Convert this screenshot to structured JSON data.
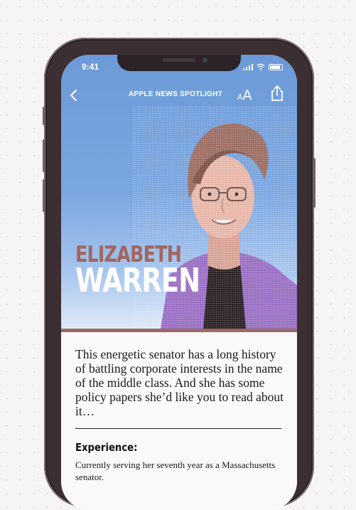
{
  "status_bar": {
    "time": "9:41",
    "icons": [
      "signal-icon",
      "wifi-icon",
      "battery-icon"
    ]
  },
  "navbar": {
    "back_icon": "chevron-left-icon",
    "title": "APPLE NEWS SPOTLIGHT",
    "text_size_small": "A",
    "text_size_large": "A",
    "share_icon": "share-icon"
  },
  "hero": {
    "first_name": "ELIZABETH",
    "last_name": "WARREN",
    "colors": {
      "sky": "#7aa6e0",
      "jacket": "#9a6fc4",
      "first_name": "#a1665f",
      "band": "#9b6a66"
    }
  },
  "article": {
    "lede": "This energetic senator has a long history of battling corporate interests in the name of the middle class. And she has some policy papers she’d like you to read about it…",
    "section_heading": "Experience:",
    "section_body": "Currently serving her seventh year as a Massachusetts senator."
  }
}
